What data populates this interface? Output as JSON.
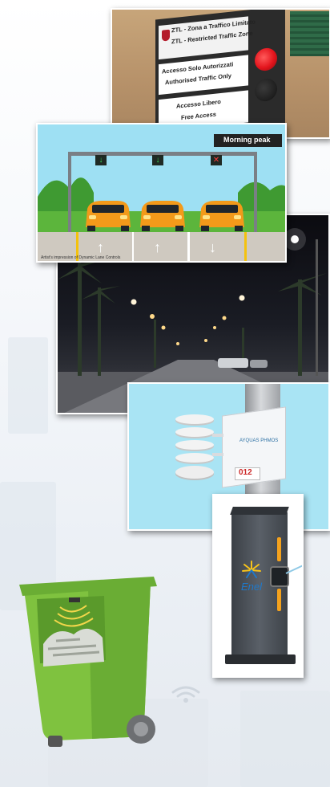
{
  "ztl_sign": {
    "line1": "ZTL - Zona a Traffico Limitato",
    "line2": "ZTL - Restricted Traffic Zone",
    "mid1": "Accesso Solo Autorizzati",
    "mid2": "Authorised Traffic Only",
    "low1": "Accesso Libero",
    "low2": "Free Access",
    "colors": {
      "red_light": "#e3141c",
      "sign_dark": "#2b2b2b"
    }
  },
  "lane_control": {
    "badge": "Morning peak",
    "caption": "Artist's impression of Dynamic Lane Controls",
    "lane_arrows": [
      "up-arrow-icon",
      "up-arrow-icon",
      "down-arrow-icon"
    ],
    "gantry_signals": [
      "down-arrow-icon",
      "down-arrow-icon",
      "x-icon"
    ],
    "colors": {
      "sky": "#9ee0f3",
      "car": "#f39a1a",
      "grass": "#5cb53c"
    }
  },
  "sensor": {
    "brand": "AYQUAS PHMOS",
    "id": "012",
    "colors": {
      "box_label": "#cc2a2a"
    }
  },
  "charger": {
    "brand": "Enel",
    "colors": {
      "brand_blue": "#1f78c8",
      "body": "#4a4f56",
      "strip": "#f4a21d"
    }
  },
  "bin": {
    "colors": {
      "body": "#7fc23f",
      "lid": "#6aad34"
    }
  }
}
